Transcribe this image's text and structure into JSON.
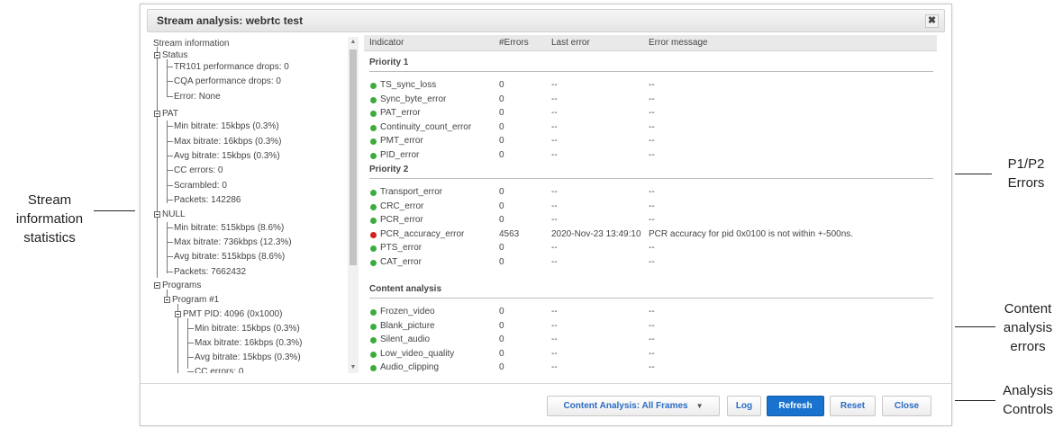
{
  "annotations": {
    "left": [
      "Stream",
      "information",
      "statistics"
    ],
    "p12": [
      "P1/P2",
      "Errors"
    ],
    "content": [
      "Content",
      "analysis",
      "errors"
    ],
    "controls": [
      "Analysis",
      "Controls"
    ]
  },
  "dialog": {
    "title": "Stream analysis: webrtc  test",
    "close_glyph": "✖"
  },
  "tree": {
    "root": "Stream information",
    "status": "Status",
    "status_items": [
      "TR101 performance drops: 0",
      "CQA performance drops: 0",
      "Error: None"
    ],
    "pat": "PAT",
    "pat_items": [
      "Min bitrate: 15kbps (0.3%)",
      "Max bitrate: 16kbps (0.3%)",
      "Avg bitrate: 15kbps (0.3%)",
      "CC errors: 0",
      "Scrambled: 0",
      "Packets: 142286"
    ],
    "null": "NULL",
    "null_items": [
      "Min bitrate: 515kbps (8.6%)",
      "Max bitrate: 736kbps (12.3%)",
      "Avg bitrate: 515kbps (8.6%)",
      "Packets: 7662432"
    ],
    "programs": "Programs",
    "program1": "Program #1",
    "pmt": "PMT PID: 4096 (0x1000)",
    "pmt_items": [
      "Min bitrate: 15kbps (0.3%)",
      "Max bitrate: 16kbps (0.3%)",
      "Avg bitrate: 15kbps (0.3%)",
      "CC errors: 0"
    ]
  },
  "scrollbar": {
    "up": "▲",
    "down": "▼"
  },
  "table": {
    "headers": {
      "indicator": "Indicator",
      "errors": "#Errors",
      "last": "Last error",
      "message": "Error message"
    },
    "priority1": {
      "title": "Priority 1",
      "rows": [
        {
          "name": "TS_sync_loss",
          "status": "ok",
          "errors": "0",
          "last": "--",
          "message": "--"
        },
        {
          "name": "Sync_byte_error",
          "status": "ok",
          "errors": "0",
          "last": "--",
          "message": "--"
        },
        {
          "name": "PAT_error",
          "status": "ok",
          "errors": "0",
          "last": "--",
          "message": "--"
        },
        {
          "name": "Continuity_count_error",
          "status": "ok",
          "errors": "0",
          "last": "--",
          "message": "--"
        },
        {
          "name": "PMT_error",
          "status": "ok",
          "errors": "0",
          "last": "--",
          "message": "--"
        },
        {
          "name": "PID_error",
          "status": "ok",
          "errors": "0",
          "last": "--",
          "message": "--"
        }
      ]
    },
    "priority2": {
      "title": "Priority 2",
      "rows": [
        {
          "name": "Transport_error",
          "status": "ok",
          "errors": "0",
          "last": "--",
          "message": "--"
        },
        {
          "name": "CRC_error",
          "status": "ok",
          "errors": "0",
          "last": "--",
          "message": "--"
        },
        {
          "name": "PCR_error",
          "status": "ok",
          "errors": "0",
          "last": "--",
          "message": "--"
        },
        {
          "name": "PCR_accuracy_error",
          "status": "error",
          "errors": "4563",
          "last": "2020-Nov-23 13:49:10",
          "message": "PCR accuracy for pid 0x0100 is not within +-500ns."
        },
        {
          "name": "PTS_error",
          "status": "ok",
          "errors": "0",
          "last": "--",
          "message": "--"
        },
        {
          "name": "CAT_error",
          "status": "ok",
          "errors": "0",
          "last": "--",
          "message": "--"
        }
      ]
    },
    "content": {
      "title": "Content analysis",
      "rows": [
        {
          "name": "Frozen_video",
          "status": "ok",
          "errors": "0",
          "last": "--",
          "message": "--"
        },
        {
          "name": "Blank_picture",
          "status": "ok",
          "errors": "0",
          "last": "--",
          "message": "--"
        },
        {
          "name": "Silent_audio",
          "status": "ok",
          "errors": "0",
          "last": "--",
          "message": "--"
        },
        {
          "name": "Low_video_quality",
          "status": "ok",
          "errors": "0",
          "last": "--",
          "message": "--"
        },
        {
          "name": "Audio_clipping",
          "status": "ok",
          "errors": "0",
          "last": "--",
          "message": "--"
        }
      ]
    }
  },
  "colors": {
    "ok": "#3eab3e",
    "error": "#d32121",
    "primary": "#1a72cf",
    "link": "#2a6cc2"
  },
  "controls": {
    "content_analysis": "Content Analysis: All Frames",
    "content_analysis_caret": "▼",
    "log": "Log",
    "refresh": "Refresh",
    "reset": "Reset",
    "close": "Close"
  }
}
